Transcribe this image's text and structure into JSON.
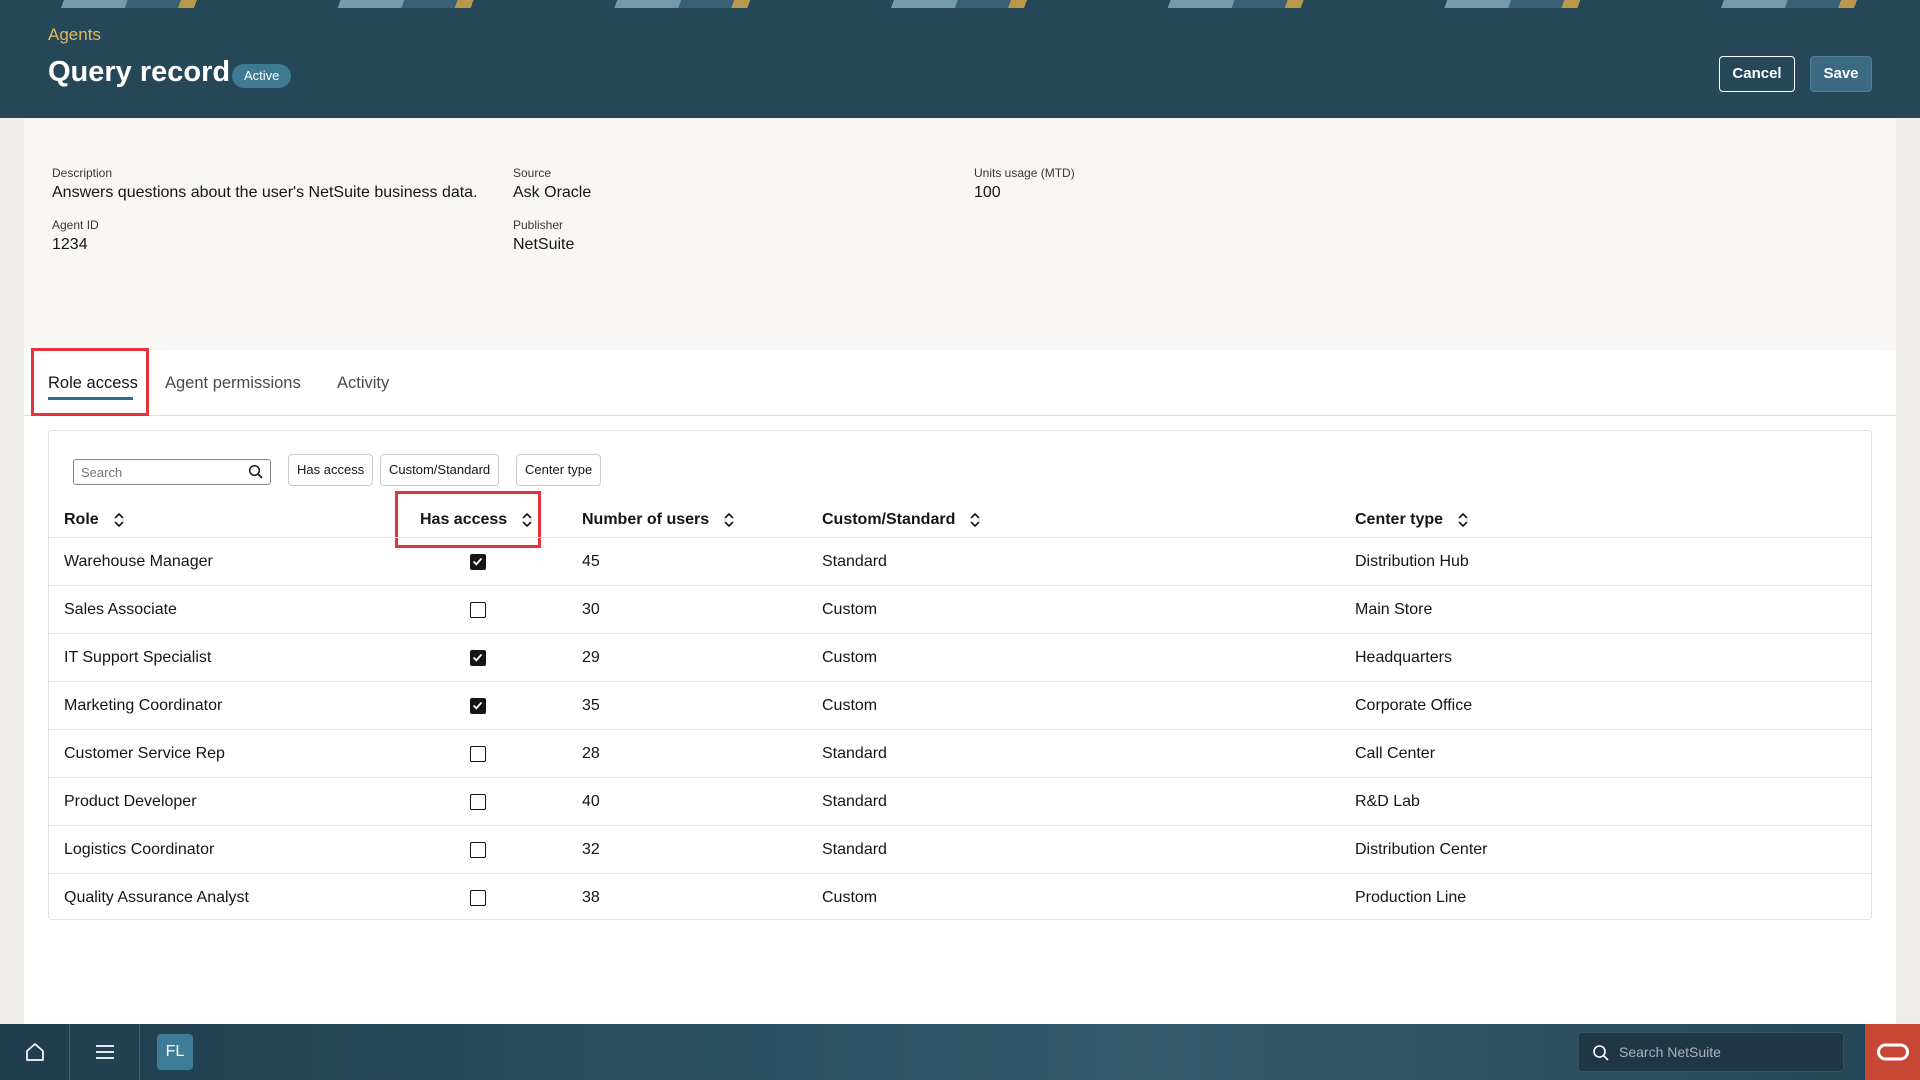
{
  "header": {
    "breadcrumb": "Agents",
    "title": "Query record",
    "status": "Active",
    "cancel_label": "Cancel",
    "save_label": "Save"
  },
  "info": {
    "description_label": "Description",
    "description_value": "Answers questions about the user's NetSuite business data.",
    "source_label": "Source",
    "source_value": "Ask Oracle",
    "units_label": "Units usage (MTD)",
    "units_value": "100",
    "agent_id_label": "Agent ID",
    "agent_id_value": "1234",
    "publisher_label": "Publisher",
    "publisher_value": "NetSuite"
  },
  "tabs": [
    {
      "label": "Role access",
      "active": true
    },
    {
      "label": "Agent permissions",
      "active": false
    },
    {
      "label": "Activity",
      "active": false
    }
  ],
  "filters": {
    "search_placeholder": "Search",
    "chips": [
      "Has access",
      "Custom/Standard",
      "Center type"
    ]
  },
  "table": {
    "columns": [
      "Role",
      "Has access",
      "Number of users",
      "Custom/Standard",
      "Center type"
    ],
    "rows": [
      {
        "role": "Warehouse Manager",
        "has_access": true,
        "users": "45",
        "type": "Standard",
        "center": "Distribution Hub"
      },
      {
        "role": "Sales Associate",
        "has_access": false,
        "users": "30",
        "type": "Custom",
        "center": "Main Store"
      },
      {
        "role": "IT Support Specialist",
        "has_access": true,
        "users": "29",
        "type": "Custom",
        "center": "Headquarters"
      },
      {
        "role": "Marketing Coordinator",
        "has_access": true,
        "users": "35",
        "type": "Custom",
        "center": "Corporate Office"
      },
      {
        "role": "Customer Service Rep",
        "has_access": false,
        "users": "28",
        "type": "Standard",
        "center": "Call Center"
      },
      {
        "role": "Product Developer",
        "has_access": false,
        "users": "40",
        "type": "Standard",
        "center": "R&D Lab"
      },
      {
        "role": "Logistics Coordinator",
        "has_access": false,
        "users": "32",
        "type": "Standard",
        "center": "Distribution Center"
      },
      {
        "role": "Quality Assurance Analyst",
        "has_access": false,
        "users": "38",
        "type": "Custom",
        "center": "Production Line"
      }
    ]
  },
  "bottombar": {
    "avatar_initials": "FL",
    "search_placeholder": "Search NetSuite",
    "icons": [
      "home-icon",
      "menu-icon",
      "search-icon",
      "oracle-logo-icon"
    ]
  },
  "colors": {
    "header_bg": "#254758",
    "breadcrumb": "#e2b95c",
    "accent": "#2b6d8d",
    "highlight": "#e5333d",
    "oracle_red": "#c74634"
  }
}
